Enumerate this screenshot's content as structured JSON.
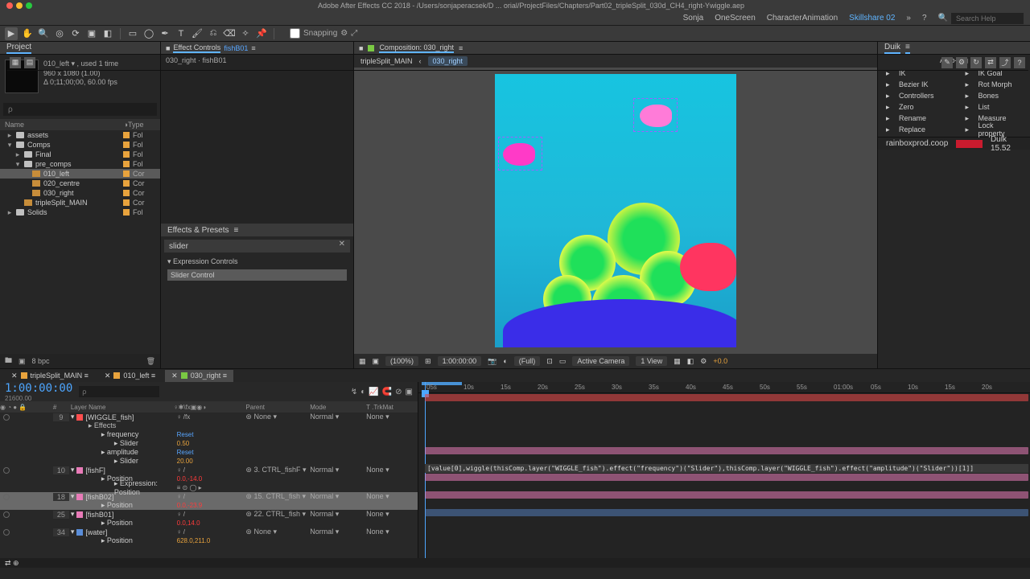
{
  "title": "Adobe After Effects CC 2018 - /Users/sonjaperacsek/D ... orial/ProjectFiles/Chapters/Part02_tripleSplit_030d_CH4_right-Ywiggle.aep",
  "topmenu": {
    "user": "Sonja",
    "ws1": "OneScreen",
    "ws2": "CharacterAnimation",
    "ws3": "Skillshare 02",
    "question": "?",
    "search_ph": "Search Help",
    "search_icon": "🔍"
  },
  "toolbar": {
    "snapping": "Snapping"
  },
  "project": {
    "tab": "Project",
    "item_name": "010_left ▾ , used 1 time",
    "dims": "960 x 1080 (1.00)",
    "dur": "Δ 0;11;00;00, 60.00 fps",
    "search_ph": "ρ",
    "head_name": "Name",
    "head_type": "Type",
    "tree": [
      {
        "tri": "▸",
        "icon": "folder",
        "name": "assets",
        "type": "Fol",
        "lbl": "orange"
      },
      {
        "tri": "▾",
        "icon": "folder",
        "name": "Comps",
        "type": "Fol",
        "lbl": "orange"
      },
      {
        "tri": "▸",
        "icon": "folder",
        "name": "Final",
        "type": "Fol",
        "lbl": "orange",
        "indent": 1
      },
      {
        "tri": "▾",
        "icon": "folder",
        "name": "pre_comps",
        "type": "Fol",
        "lbl": "orange",
        "indent": 1
      },
      {
        "tri": "",
        "icon": "comp",
        "name": "010_left",
        "type": "Cor",
        "lbl": "orange",
        "indent": 2,
        "hl": true
      },
      {
        "tri": "",
        "icon": "comp",
        "name": "020_centre",
        "type": "Cor",
        "lbl": "orange",
        "indent": 2
      },
      {
        "tri": "",
        "icon": "comp",
        "name": "030_right",
        "type": "Cor",
        "lbl": "orange",
        "indent": 2
      },
      {
        "tri": "",
        "icon": "comp",
        "name": "tripleSplit_MAIN",
        "type": "Cor",
        "lbl": "orange",
        "indent": 1
      },
      {
        "tri": "▸",
        "icon": "folder",
        "name": "Solids",
        "type": "Fol",
        "lbl": "orange"
      }
    ],
    "foot": "8 bpc"
  },
  "effect_controls": {
    "tab": "Effect Controls",
    "link": "fishB01",
    "crumb": "030_right · fishB01"
  },
  "effects_presets": {
    "title": "Effects & Presets",
    "search": "slider",
    "cat": "▾ Expression Controls",
    "item": "Slider Control"
  },
  "composition": {
    "tab": "Composition:",
    "tabname": "030_right",
    "crumb_main": "tripleSplit_MAIN",
    "crumb_sep": "‹",
    "crumb_curr": "030_right",
    "foot": {
      "zoom": "(100%)",
      "tc": "1:00:00:00",
      "snap_ic": "📷",
      "res": "(Full)",
      "camera": "Active Camera",
      "view": "1 View",
      "exp": "+0.0"
    }
  },
  "duik": {
    "title": "Duik",
    "autorig": "Auto-Rig",
    "items": [
      [
        "IK",
        "IK Goal"
      ],
      [
        "Bezier IK",
        "Rot Morph"
      ],
      [
        "Controllers",
        "Bones"
      ],
      [
        "Zero",
        "List"
      ],
      [
        "Rename",
        "Measure"
      ],
      [
        "Replace",
        "Lock property"
      ]
    ],
    "foot": "rainboxprod.coop",
    "logo": "RAINBOX",
    "ver": "Duik 15.52"
  },
  "timeline": {
    "tabs": [
      {
        "label": "tripleSplit_MAIN",
        "color": "#e8a33d"
      },
      {
        "label": "010_left",
        "color": "#e8a33d"
      },
      {
        "label": "030_right",
        "color": "#7ac943",
        "active": true
      }
    ],
    "timecode": "1:00:00:00",
    "frame": "21600.00",
    "cols": {
      "num": "#",
      "name": "Layer Name",
      "parent": "Parent",
      "mode": "Mode",
      "trk": "T .TrkMat"
    },
    "ticks": [
      "05s",
      "10s",
      "15s",
      "20s",
      "25s",
      "30s",
      "35s",
      "40s",
      "45s",
      "50s",
      "55s",
      "01:00s",
      "05s",
      "10s",
      "15s",
      "20s"
    ],
    "expression": "[value[0],wiggle(thisComp.layer(\"WIGGLE_fish\").effect(\"frequency\")(\"Slider\"),thisComp.layer(\"WIGGLE_fish\").effect(\"amplitude\")(\"Slider\"))[1]]",
    "rows": [
      {
        "kind": "layer",
        "num": "9",
        "swatch": "sw-red",
        "name": "WIGGLE_fish",
        "switches": "♀   /fx",
        "parent": "None",
        "mode": "Normal",
        "trk": "None"
      },
      {
        "kind": "prop",
        "name": "Effects"
      },
      {
        "kind": "prop2",
        "name": "frequency",
        "val": "Reset"
      },
      {
        "kind": "prop3",
        "name": "Slider",
        "val": "0.50"
      },
      {
        "kind": "prop2",
        "name": "amplitude",
        "val": "Reset"
      },
      {
        "kind": "prop3",
        "name": "Slider",
        "val": "20.00"
      },
      {
        "kind": "layer",
        "num": "10",
        "swatch": "sw-pink",
        "name": "fishF",
        "switches": "♀   /",
        "parent": "3. CTRL_fishF",
        "mode": "Normal",
        "trk": "None"
      },
      {
        "kind": "prop2",
        "name": "Position",
        "hot": "0.0,-14.0"
      },
      {
        "kind": "prop3",
        "name": "Expression: Position",
        "icons": "≡ ⊙ ◯ ▸"
      },
      {
        "kind": "layer",
        "num": "18",
        "swatch": "sw-pink",
        "name": "fishB02",
        "sel": true,
        "switches": "♀   /",
        "parent": "15. CTRL_fish",
        "mode": "Normal",
        "trk": "None"
      },
      {
        "kind": "prop2",
        "name": "Position",
        "hot": "0.0,-23.9",
        "sel": true
      },
      {
        "kind": "layer",
        "num": "25",
        "swatch": "sw-pink",
        "name": "fishB01",
        "switches": "♀   /",
        "parent": "22. CTRL_fish",
        "mode": "Normal",
        "trk": "None"
      },
      {
        "kind": "prop2",
        "name": "Position",
        "hot": "0.0,14.0"
      },
      {
        "kind": "layer",
        "num": "34",
        "swatch": "sw-blue",
        "name": "water",
        "switches": "♀   /",
        "parent": "None",
        "mode": "Normal",
        "trk": "None"
      },
      {
        "kind": "prop2",
        "name": "Position",
        "val": "628.0,211.0"
      }
    ]
  }
}
